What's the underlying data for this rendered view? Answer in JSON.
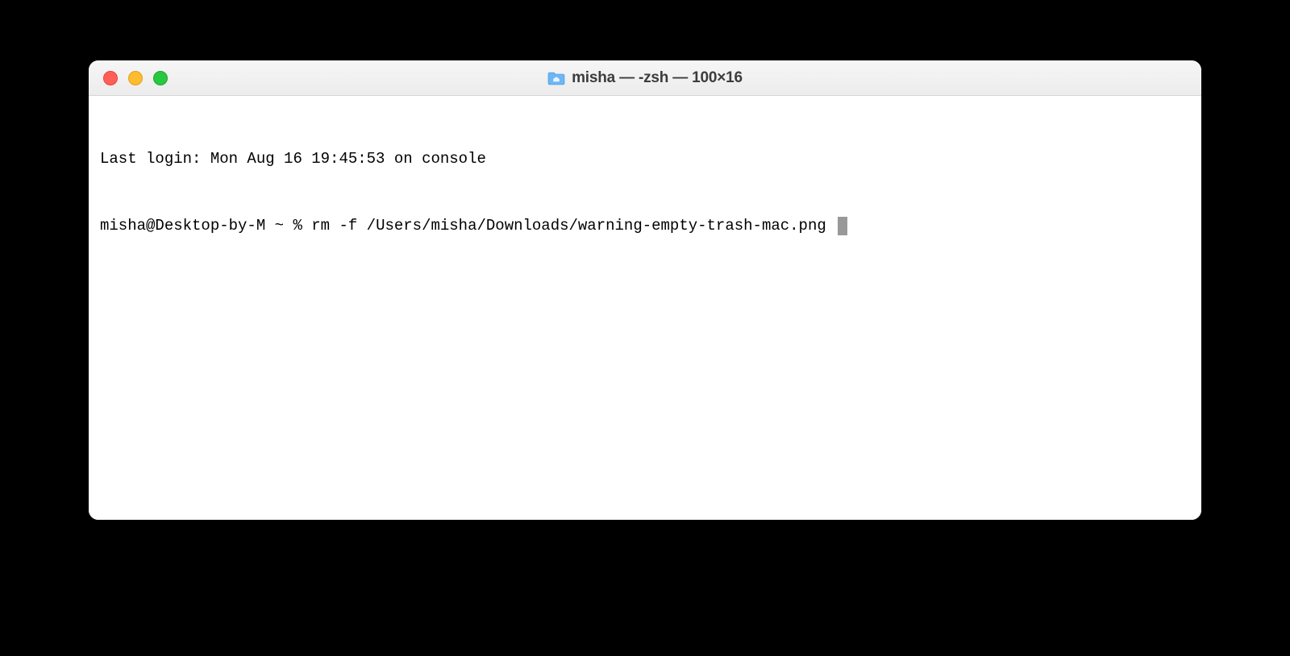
{
  "window": {
    "title": "misha — -zsh — 100×16"
  },
  "terminal": {
    "lines": [
      "Last login: Mon Aug 16 19:45:53 on console"
    ],
    "prompt": "misha@Desktop-by-M ~ % ",
    "command": "rm -f /Users/misha/Downloads/warning-empty-trash-mac.png "
  }
}
